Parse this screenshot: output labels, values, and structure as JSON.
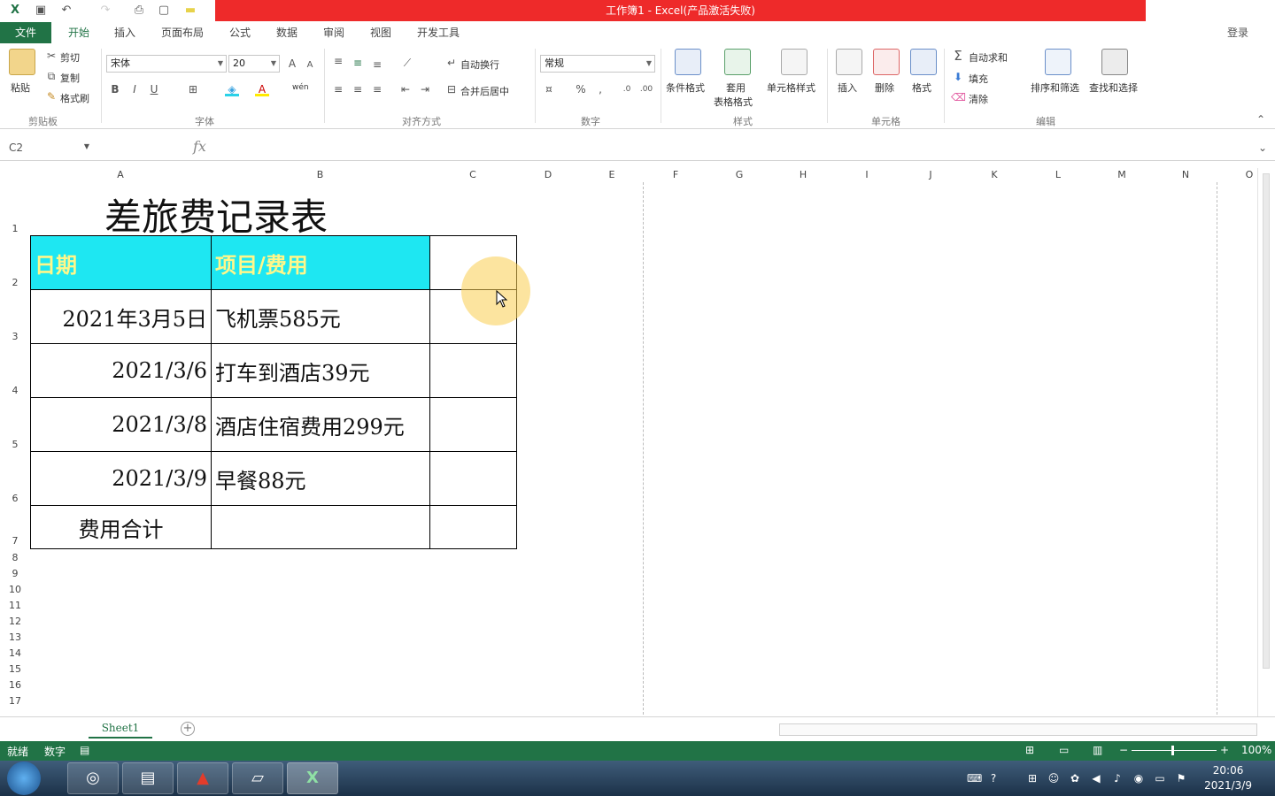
{
  "window": {
    "title": "工作簿1 - Excel(产品激活失败)"
  },
  "ribbon_tabs": [
    {
      "label": "文件"
    },
    {
      "label": "开始"
    },
    {
      "label": "插入"
    },
    {
      "label": "页面布局"
    },
    {
      "label": "公式"
    },
    {
      "label": "数据"
    },
    {
      "label": "审阅"
    },
    {
      "label": "视图"
    },
    {
      "label": "开发工具"
    }
  ],
  "account": {
    "login_label": "登录"
  },
  "ribbon": {
    "clipboard": {
      "paste": "粘贴",
      "cut": "剪切",
      "copy": "复制",
      "format_painter": "格式刷",
      "group": "剪贴板"
    },
    "font": {
      "name": "宋体",
      "size": "20",
      "group": "字体",
      "bold": "B",
      "italic": "I",
      "underline": "U",
      "phonetic": "wén"
    },
    "alignment": {
      "wrap": "自动换行",
      "merge": "合并后居中",
      "group": "对齐方式"
    },
    "number": {
      "format": "常规",
      "percent": "%",
      "comma": ",",
      "group": "数字"
    },
    "styles": {
      "conditional": "条件格式",
      "table_l1": "套用",
      "table_l2": "表格格式",
      "cell_styles": "单元格样式",
      "group": "样式"
    },
    "cells": {
      "insert": "插入",
      "delete": "删除",
      "format": "格式",
      "group": "单元格"
    },
    "editing": {
      "autosum": "自动求和",
      "fill": "填充",
      "clear": "清除",
      "sort": "排序和筛选",
      "find": "查找和选择",
      "group": "编辑"
    }
  },
  "formula_bar": {
    "name_box": "C2",
    "fx": "fx",
    "content": ""
  },
  "columns": [
    "A",
    "B",
    "C",
    "D",
    "E",
    "F",
    "G",
    "H",
    "I",
    "J",
    "K",
    "L",
    "M",
    "N",
    "O"
  ],
  "rows": [
    "1",
    "2",
    "3",
    "4",
    "5",
    "6",
    "7",
    "8",
    "9",
    "10",
    "11",
    "12",
    "13",
    "14",
    "15",
    "16",
    "17"
  ],
  "sheet": {
    "title": "差旅费记录表",
    "header": {
      "date": "日期",
      "item": "项目/费用",
      "c": ""
    },
    "records": [
      {
        "date": "2021年3月5日",
        "item": "飞机票585元"
      },
      {
        "date": "2021/3/6",
        "item": "打车到酒店39元"
      },
      {
        "date": "2021/3/8",
        "item": "酒店住宿费用299元"
      },
      {
        "date": "2021/3/9",
        "item": "早餐88元"
      }
    ],
    "total_label": "费用合计"
  },
  "sheet_tabs": [
    {
      "label": "Sheet1"
    }
  ],
  "status": {
    "ready": "就绪",
    "mode": "数字",
    "zoom": "100%"
  },
  "taskbar": {
    "time": "20:06",
    "date": "2021/3/9"
  },
  "colors": {
    "accent": "#217346",
    "header_fill": "#1ee7f2",
    "header_text": "#fff78a",
    "title_band": "#ee2a2a"
  }
}
